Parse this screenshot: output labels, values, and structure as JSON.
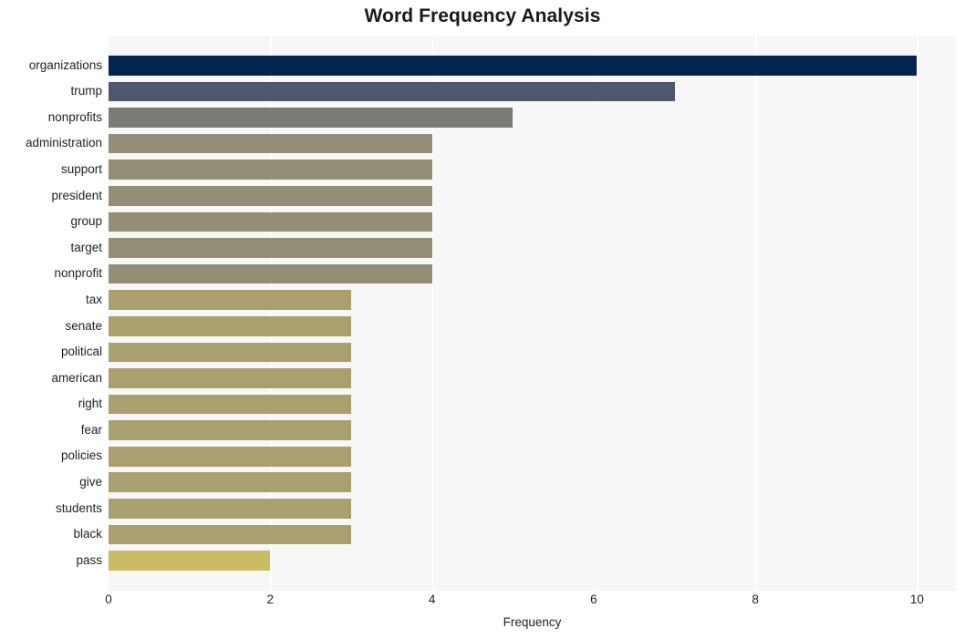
{
  "chart_data": {
    "type": "bar",
    "orientation": "horizontal",
    "title": "Word Frequency Analysis",
    "xlabel": "Frequency",
    "ylabel": "",
    "xlim": [
      0,
      10.48
    ],
    "xticks": [
      0,
      2,
      4,
      6,
      8,
      10
    ],
    "xtick_labels": [
      "0",
      "2",
      "4",
      "6",
      "8",
      "10"
    ],
    "grid": true,
    "grid_axis": "x",
    "grid_color": "#ffffff",
    "plot_background": "#f7f7f7",
    "figure_background": "#ffffff",
    "legend": null,
    "categories": [
      "organizations",
      "trump",
      "nonprofits",
      "administration",
      "support",
      "president",
      "group",
      "target",
      "nonprofit",
      "tax",
      "senate",
      "political",
      "american",
      "right",
      "fear",
      "policies",
      "give",
      "students",
      "black",
      "pass"
    ],
    "values": [
      10,
      7,
      5,
      4,
      4,
      4,
      4,
      4,
      4,
      3,
      3,
      3,
      3,
      3,
      3,
      3,
      3,
      3,
      3,
      2
    ],
    "bar_colors": [
      "#032550",
      "#4f5770",
      "#7b7a77",
      "#938e75",
      "#938e75",
      "#938e75",
      "#938e75",
      "#938e75",
      "#938e75",
      "#aa9f6e",
      "#aa9f6e",
      "#aa9f6e",
      "#aa9f6e",
      "#aa9f6e",
      "#aa9f6e",
      "#aa9f6e",
      "#aa9f6e",
      "#aa9f6e",
      "#aa9f6e",
      "#c9bc63"
    ],
    "bars": [
      {
        "label": "organizations",
        "value": 10,
        "color": "#032550"
      },
      {
        "label": "trump",
        "value": 7,
        "color": "#4f5770"
      },
      {
        "label": "nonprofits",
        "value": 5,
        "color": "#7b7a77"
      },
      {
        "label": "administration",
        "value": 4,
        "color": "#938e75"
      },
      {
        "label": "support",
        "value": 4,
        "color": "#938e75"
      },
      {
        "label": "president",
        "value": 4,
        "color": "#938e75"
      },
      {
        "label": "group",
        "value": 4,
        "color": "#938e75"
      },
      {
        "label": "target",
        "value": 4,
        "color": "#938e75"
      },
      {
        "label": "nonprofit",
        "value": 4,
        "color": "#938e75"
      },
      {
        "label": "tax",
        "value": 3,
        "color": "#aa9f6e"
      },
      {
        "label": "senate",
        "value": 3,
        "color": "#aa9f6e"
      },
      {
        "label": "political",
        "value": 3,
        "color": "#aa9f6e"
      },
      {
        "label": "american",
        "value": 3,
        "color": "#aa9f6e"
      },
      {
        "label": "right",
        "value": 3,
        "color": "#aa9f6e"
      },
      {
        "label": "fear",
        "value": 3,
        "color": "#aa9f6e"
      },
      {
        "label": "policies",
        "value": 3,
        "color": "#aa9f6e"
      },
      {
        "label": "give",
        "value": 3,
        "color": "#aa9f6e"
      },
      {
        "label": "students",
        "value": 3,
        "color": "#aa9f6e"
      },
      {
        "label": "black",
        "value": 3,
        "color": "#aa9f6e"
      },
      {
        "label": "pass",
        "value": 2,
        "color": "#c9bc63"
      }
    ]
  }
}
